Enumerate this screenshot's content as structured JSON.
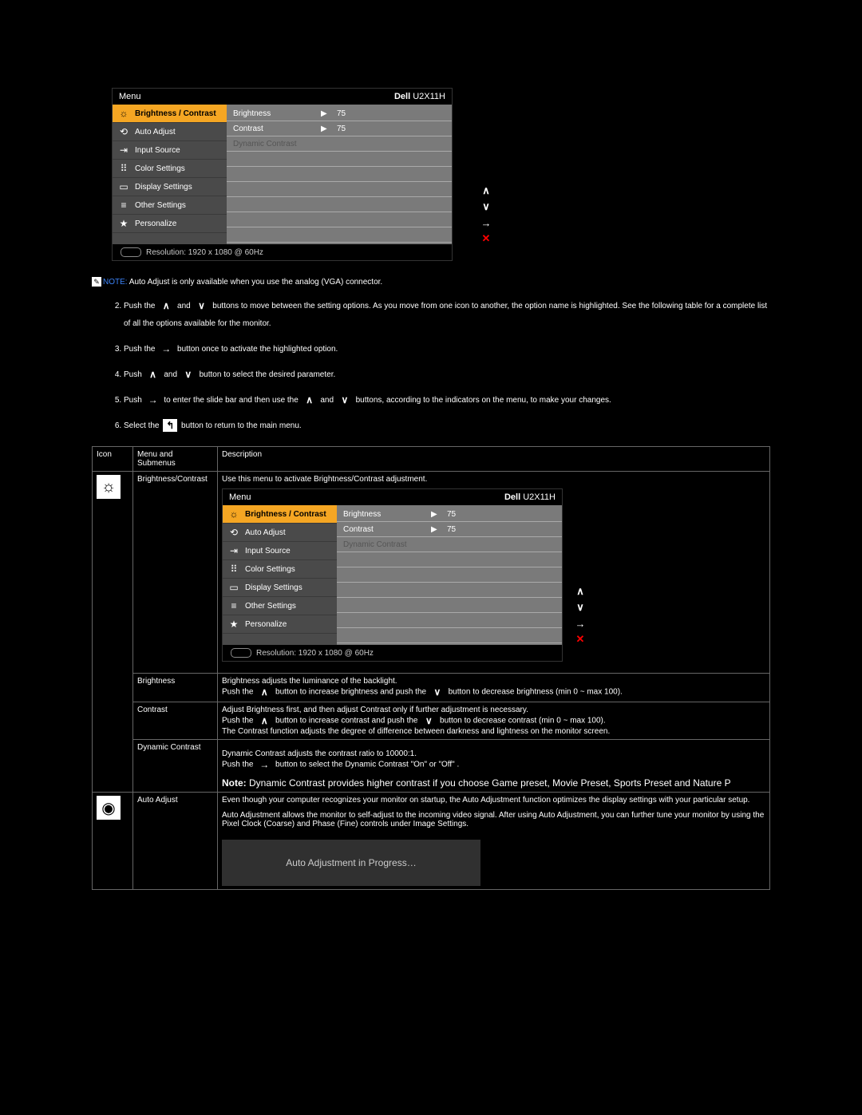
{
  "osd": {
    "menu_label": "Menu",
    "model": "Dell U2X11H",
    "model_prefix": "Dell",
    "model_suffix": " U2X11H",
    "left_items": [
      {
        "icon": "brightness-icon",
        "glyph": "☼",
        "label": "Brightness / Contrast",
        "selected": true
      },
      {
        "icon": "auto-adjust-icon",
        "glyph": "⟲",
        "label": "Auto Adjust",
        "selected": false
      },
      {
        "icon": "input-source-icon",
        "glyph": "⇥",
        "label": "Input Source",
        "selected": false
      },
      {
        "icon": "color-settings-icon",
        "glyph": "⠿",
        "label": "Color Settings",
        "selected": false
      },
      {
        "icon": "display-settings-icon",
        "glyph": "▭",
        "label": "Display Settings",
        "selected": false
      },
      {
        "icon": "other-settings-icon",
        "glyph": "≡",
        "label": "Other Settings",
        "selected": false
      },
      {
        "icon": "personalize-icon",
        "glyph": "★",
        "label": "Personalize",
        "selected": false
      }
    ],
    "right_rows": [
      {
        "label": "Brightness",
        "value": "75",
        "active": true
      },
      {
        "label": "Contrast",
        "value": "75",
        "active": true
      },
      {
        "label": "Dynamic Contrast",
        "value": "",
        "active": false
      }
    ],
    "resolution_label": "Resolution: 1920 x 1080 @ 60Hz"
  },
  "side_buttons": [
    "∧",
    "∨",
    "→",
    "✕"
  ],
  "note": {
    "label": "NOTE:",
    "text": " Auto Adjust is only available when you use the analog (VGA) connector."
  },
  "instructions": {
    "i2a": "Push the ",
    "i2b": " and ",
    "i2c": " buttons to move between the setting options. As you move from one icon to another, the option name is highlighted. See the following table for a complete list of all the options available for the monitor.",
    "i3a": "Push the ",
    "i3b": " button once to activate the highlighted option.",
    "i4a": "Push ",
    "i4b": " and ",
    "i4c": " button to select the desired parameter.",
    "i5a": "Push ",
    "i5b": " to enter the slide bar and then use the ",
    "i5c": " and ",
    "i5d": " buttons, according to the indicators on the menu, to make your changes.",
    "i6a": "Select the ",
    "i6b": " button to return to the main menu."
  },
  "table": {
    "headers": {
      "c1": "Icon",
      "c2": "Menu and Submenus",
      "c3": "Description"
    },
    "rows": {
      "brightness_contrast": {
        "menu": "Brightness/Contrast",
        "desc": "Use this menu to activate Brightness/Contrast adjustment."
      },
      "brightness": {
        "menu": "Brightness",
        "d1": "Brightness adjusts the luminance of the backlight.",
        "d2a": "Push the ",
        "d2b": " button to increase brightness and push the ",
        "d2c": " button to decrease brightness (min 0 ~ max 100)."
      },
      "contrast": {
        "menu": "Contrast",
        "d1": "Adjust Brightness first, and then adjust Contrast only if further adjustment is necessary.",
        "d2a": "Push the ",
        "d2b": " button to increase contrast and push the ",
        "d2c": " button to decrease contrast (min 0 ~ max 100).",
        "d3": "The Contrast function adjusts the degree of difference between darkness and lightness on the monitor screen."
      },
      "dynamic": {
        "menu": "Dynamic Contrast",
        "d1": "Dynamic Contrast adjusts the contrast ratio to 10000:1.",
        "d2a": "Push the ",
        "d2b": " button to select the Dynamic Contrast \"On\" or \"Off\" .",
        "note_label": "Note:",
        "note_text": " Dynamic Contrast provides higher contrast if you choose Game preset, Movie Preset, Sports Preset and Nature P"
      },
      "auto_adjust": {
        "menu": "Auto Adjust",
        "d1": "Even though your computer recognizes your monitor on startup, the Auto Adjustment function optimizes the display settings with your particular setup.",
        "d2": "Auto Adjustment allows the monitor to self-adjust to the incoming video signal. After using Auto Adjustment, you can further tune your monitor by using the Pixel Clock (Coarse) and Phase (Fine) controls under Image Settings.",
        "progress": "Auto Adjustment in Progress…"
      }
    }
  }
}
